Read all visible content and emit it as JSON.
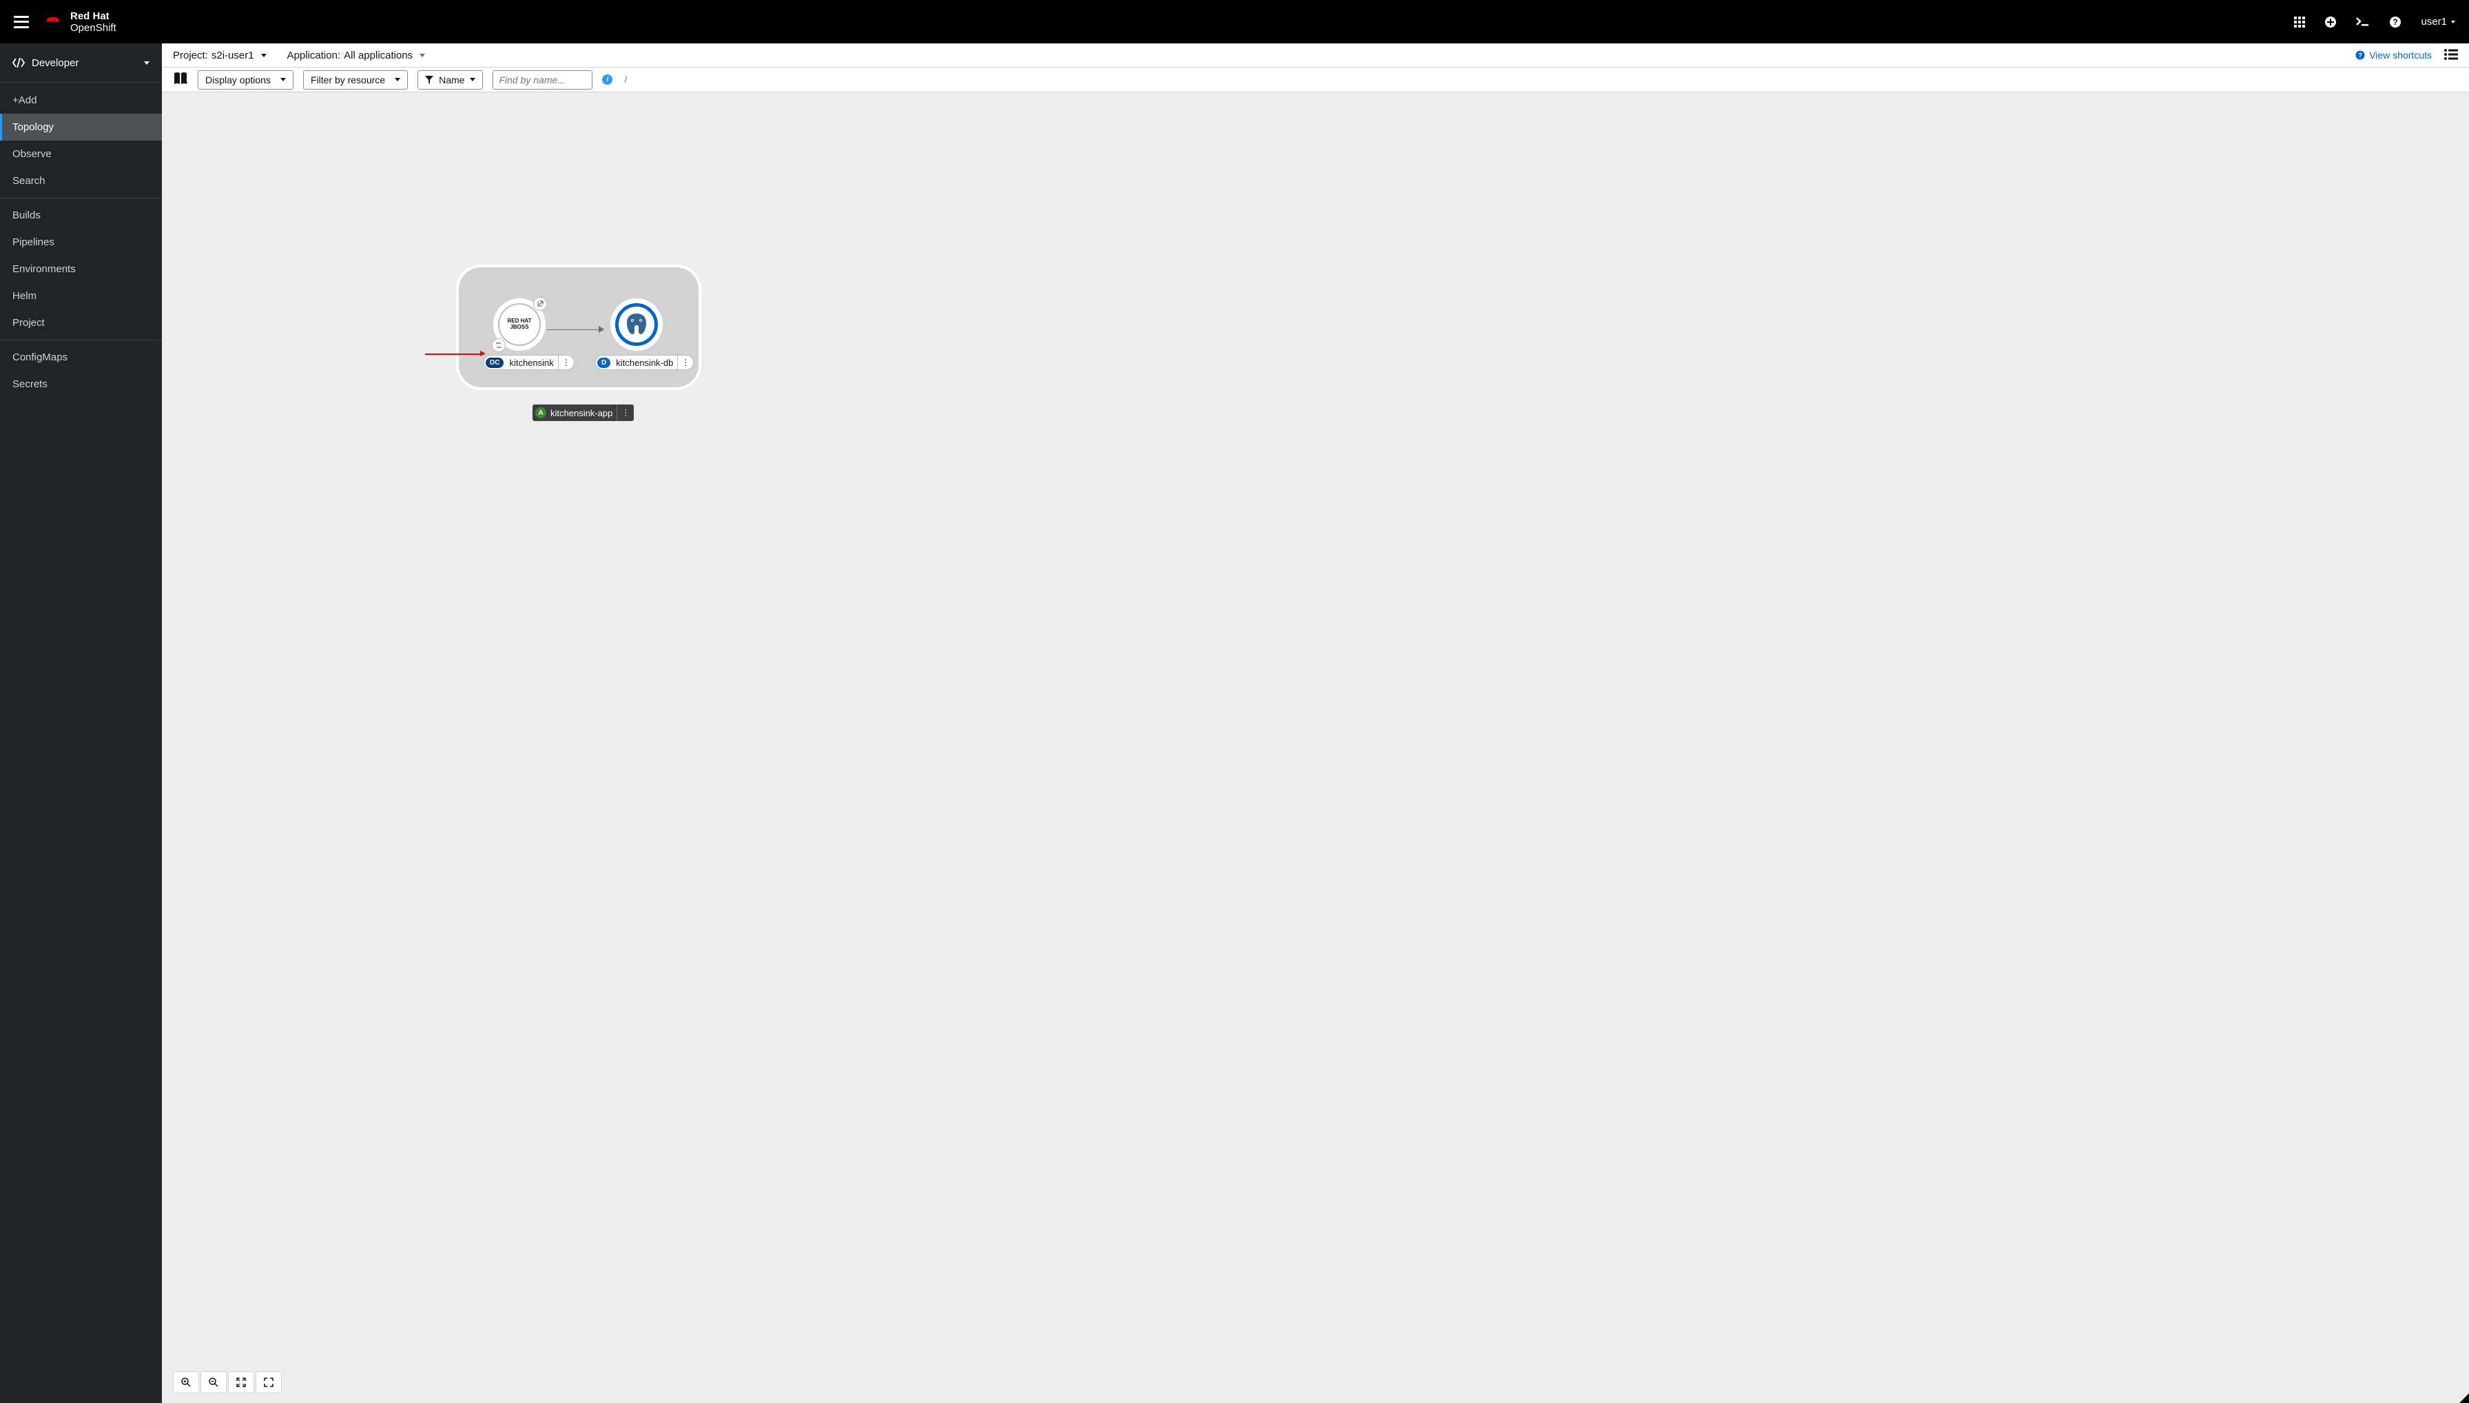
{
  "brand": {
    "line1": "Red Hat",
    "line2": "OpenShift"
  },
  "user": {
    "name": "user1"
  },
  "perspective": {
    "label": "Developer"
  },
  "sidebar": {
    "items": [
      {
        "label": "+Add"
      },
      {
        "label": "Topology"
      },
      {
        "label": "Observe"
      },
      {
        "label": "Search"
      },
      {
        "label": "Builds"
      },
      {
        "label": "Pipelines"
      },
      {
        "label": "Environments"
      },
      {
        "label": "Helm"
      },
      {
        "label": "Project"
      },
      {
        "label": "ConfigMaps"
      },
      {
        "label": "Secrets"
      }
    ]
  },
  "context": {
    "project_label": "Project:",
    "project_value": "s2i-user1",
    "application_label": "Application:",
    "application_value": "All applications",
    "shortcuts": "View shortcuts"
  },
  "toolbar": {
    "display_options": "Display options",
    "filter_resource": "Filter by resource",
    "filter_type": "Name",
    "search_placeholder": "Find by name...",
    "search_hint": "/"
  },
  "topology": {
    "app_group": {
      "name": "kitchensink-app",
      "badge": "A"
    },
    "nodes": [
      {
        "badge": "DC",
        "label": "kitchensink",
        "inner_line1": "RED HAT",
        "inner_line2": "JBOSS"
      },
      {
        "badge": "D",
        "label": "kitchensink-db"
      }
    ]
  }
}
